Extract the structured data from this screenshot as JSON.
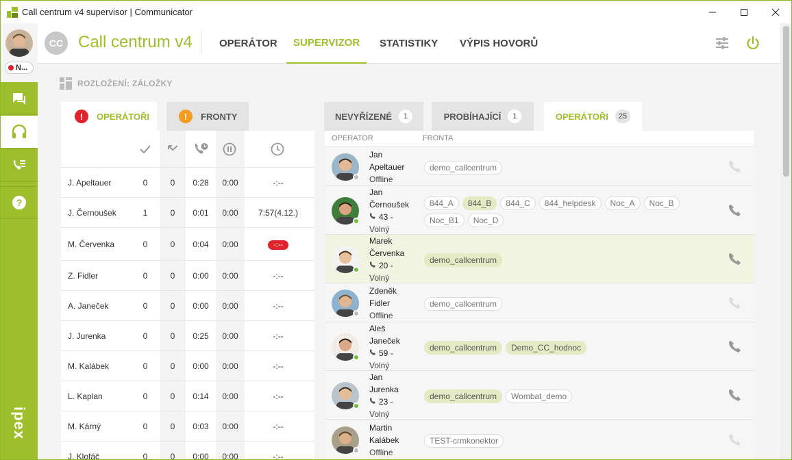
{
  "window": {
    "title": "Call centrum v4 supervisor | Communicator",
    "controls": {
      "minimize": "—",
      "maximize": "☐",
      "close": "✕"
    }
  },
  "rail": {
    "status_label": "N...",
    "items": [
      {
        "name": "chat-icon"
      },
      {
        "name": "headset-icon"
      },
      {
        "name": "call-list-icon"
      },
      {
        "name": "help-icon"
      }
    ],
    "brand": "ipex"
  },
  "header": {
    "badge": "CC",
    "app_title": "Call centrum v4",
    "tabs": [
      {
        "label": "OPERÁTOR"
      },
      {
        "label": "SUPERVIZOR"
      },
      {
        "label": "STATISTIKY"
      },
      {
        "label": "VÝPIS HOVORŮ"
      }
    ]
  },
  "layout_label": "ROZLOŽENÍ: ZÁLOŽKY",
  "left_panel": {
    "tabs": [
      {
        "label": "OPERÁTOŘI",
        "icon": "!"
      },
      {
        "label": "FRONTY",
        "icon": "!"
      }
    ],
    "rows": [
      {
        "name": "J. Apeltauer",
        "c1": "0",
        "c2": "0",
        "c3": "0:28",
        "c4": "0:00",
        "c5": "-:--"
      },
      {
        "name": "J. Černoušek",
        "c1": "1",
        "c2": "0",
        "c3": "0:01",
        "c4": "0:00",
        "c5": "7:57(4.12.)"
      },
      {
        "name": "M. Červenka",
        "c1": "0",
        "c2": "0",
        "c3": "0:04",
        "c4": "0:00",
        "c5": "-:--",
        "alert": true
      },
      {
        "name": "Z. Fidler",
        "c1": "0",
        "c2": "0",
        "c3": "0:00",
        "c4": "0:00",
        "c5": "-:--"
      },
      {
        "name": "A. Janeček",
        "c1": "0",
        "c2": "0",
        "c3": "0:00",
        "c4": "0:00",
        "c5": "-:--"
      },
      {
        "name": "J. Jurenka",
        "c1": "0",
        "c2": "0",
        "c3": "0:25",
        "c4": "0:00",
        "c5": "-:--"
      },
      {
        "name": "M. Kalábek",
        "c1": "0",
        "c2": "0",
        "c3": "0:00",
        "c4": "0:00",
        "c5": "-:--"
      },
      {
        "name": "L. Kaplan",
        "c1": "0",
        "c2": "0",
        "c3": "0:14",
        "c4": "0:00",
        "c5": "-:--"
      },
      {
        "name": "M. Kárný",
        "c1": "0",
        "c2": "0",
        "c3": "0:03",
        "c4": "0:00",
        "c5": "-:--"
      },
      {
        "name": "J. Klofáč",
        "c1": "0",
        "c2": "0",
        "c3": "0:00",
        "c4": "0:00",
        "c5": "-:--"
      }
    ]
  },
  "right_panel": {
    "tabs": [
      {
        "label": "NEVYŘÍZENÉ",
        "count": "1"
      },
      {
        "label": "PROBÍHAJÍCÍ",
        "count": "1"
      },
      {
        "label": "OPERÁTOŘI",
        "count": "25"
      }
    ],
    "columns": {
      "operator": "OPERATOR",
      "queue": "FRONTA"
    },
    "operators": [
      {
        "first": "Jan",
        "last": "Apeltauer",
        "ext": "",
        "status": "Offline",
        "online": false,
        "queues": [
          {
            "label": "demo_callcentrum",
            "on": false
          }
        ]
      },
      {
        "first": "Jan",
        "last": "Černoušek",
        "ext": "43 -",
        "status": "Volný",
        "online": true,
        "queues": [
          {
            "label": "844_A",
            "on": false
          },
          {
            "label": "844_B",
            "on": true
          },
          {
            "label": "844_C",
            "on": false
          },
          {
            "label": "844_helpdesk",
            "on": false
          },
          {
            "label": "Noc_A",
            "on": false
          },
          {
            "label": "Noc_B",
            "on": false
          },
          {
            "label": "Noc_B1",
            "on": false
          },
          {
            "label": "Noc_D",
            "on": false
          }
        ]
      },
      {
        "first": "Marek",
        "last": "Červenka",
        "ext": "20 -",
        "status": "Volný",
        "online": true,
        "selected": true,
        "queues": [
          {
            "label": "demo_callcentrum",
            "on": true
          }
        ]
      },
      {
        "first": "Zdeněk",
        "last": "Fidler",
        "ext": "",
        "status": "Offline",
        "online": false,
        "queues": [
          {
            "label": "demo_callcentrum",
            "on": false
          }
        ]
      },
      {
        "first": "Aleš",
        "last": "Janeček",
        "ext": "59 -",
        "status": "Volný",
        "online": true,
        "queues": [
          {
            "label": "demo_callcentrum",
            "on": true
          },
          {
            "label": "Demo_CC_hodnoc",
            "on": true
          }
        ]
      },
      {
        "first": "Jan",
        "last": "Jurenka",
        "ext": "23 -",
        "status": "Volný",
        "online": true,
        "queues": [
          {
            "label": "demo_callcentrum",
            "on": true
          },
          {
            "label": "Wombat_demo",
            "on": false
          }
        ]
      },
      {
        "first": "Martin",
        "last": "Kalábek",
        "ext": "",
        "status": "Offline",
        "online": false,
        "queues": [
          {
            "label": "TEST-crmkonektor",
            "on": false
          }
        ]
      }
    ]
  },
  "colors": {
    "accent": "#9cbf2b",
    "alert": "#e1232b",
    "warning": "#f39c1f",
    "online": "#6fbf3a",
    "offline": "#bbbbbb"
  }
}
